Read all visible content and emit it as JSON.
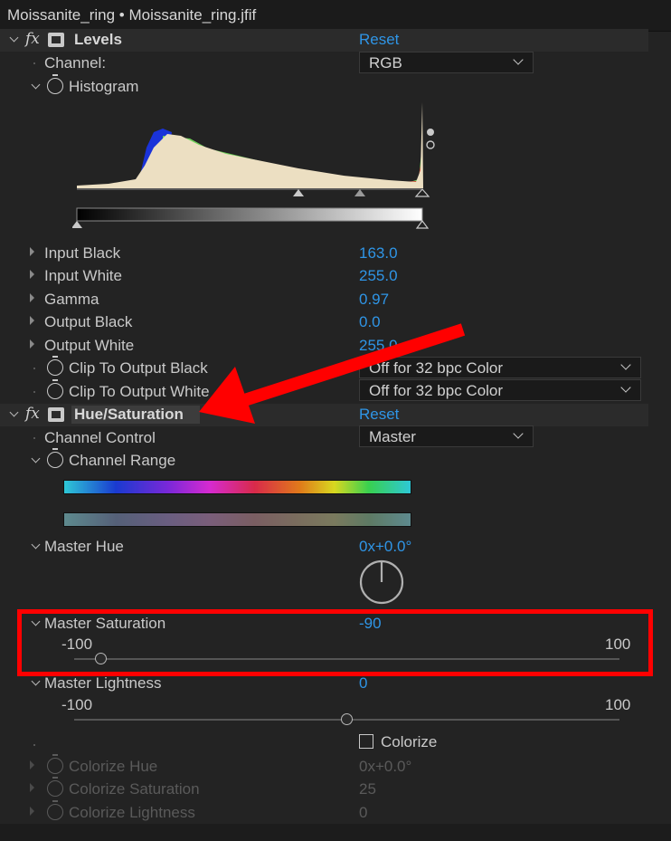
{
  "title": "Moissanite_ring • Moissanite_ring.jfif",
  "levels": {
    "fx": "fx",
    "name": "Levels",
    "reset": "Reset",
    "channel_label": "Channel:",
    "channel_value": "RGB",
    "histogram_label": "Histogram",
    "params": [
      {
        "label": "Input Black",
        "value": "163.0"
      },
      {
        "label": "Input White",
        "value": "255.0"
      },
      {
        "label": "Gamma",
        "value": "0.97"
      },
      {
        "label": "Output Black",
        "value": "0.0"
      },
      {
        "label": "Output White",
        "value": "255.0"
      }
    ],
    "clip_black_label": "Clip To Output Black",
    "clip_black_value": "Off for 32 bpc Color",
    "clip_white_label": "Clip To Output White",
    "clip_white_value": "Off for 32 bpc Color"
  },
  "hue_sat": {
    "fx": "fx",
    "name": "Hue/Saturation",
    "reset": "Reset",
    "channel_control_label": "Channel Control",
    "channel_control_value": "Master",
    "channel_range_label": "Channel Range",
    "master_hue_label": "Master Hue",
    "master_hue_value": "0x+0.0°",
    "master_saturation_label": "Master Saturation",
    "master_saturation_value": "-90",
    "master_saturation_min": "-100",
    "master_saturation_max": "100",
    "master_saturation_level": 0.05,
    "master_lightness_label": "Master Lightness",
    "master_lightness_value": "0",
    "master_lightness_min": "-100",
    "master_lightness_max": "100",
    "master_lightness_level": 0.5,
    "colorize_label": "Colorize",
    "colorize_hue_label": "Colorize Hue",
    "colorize_hue_value": "0x+0.0°",
    "colorize_saturation_label": "Colorize Saturation",
    "colorize_saturation_value": "25",
    "colorize_lightness_label": "Colorize Lightness",
    "colorize_lightness_value": "0"
  },
  "colors": {
    "accent": "#2f95e6",
    "highlight": "#ff0000",
    "panel": "#232323"
  }
}
